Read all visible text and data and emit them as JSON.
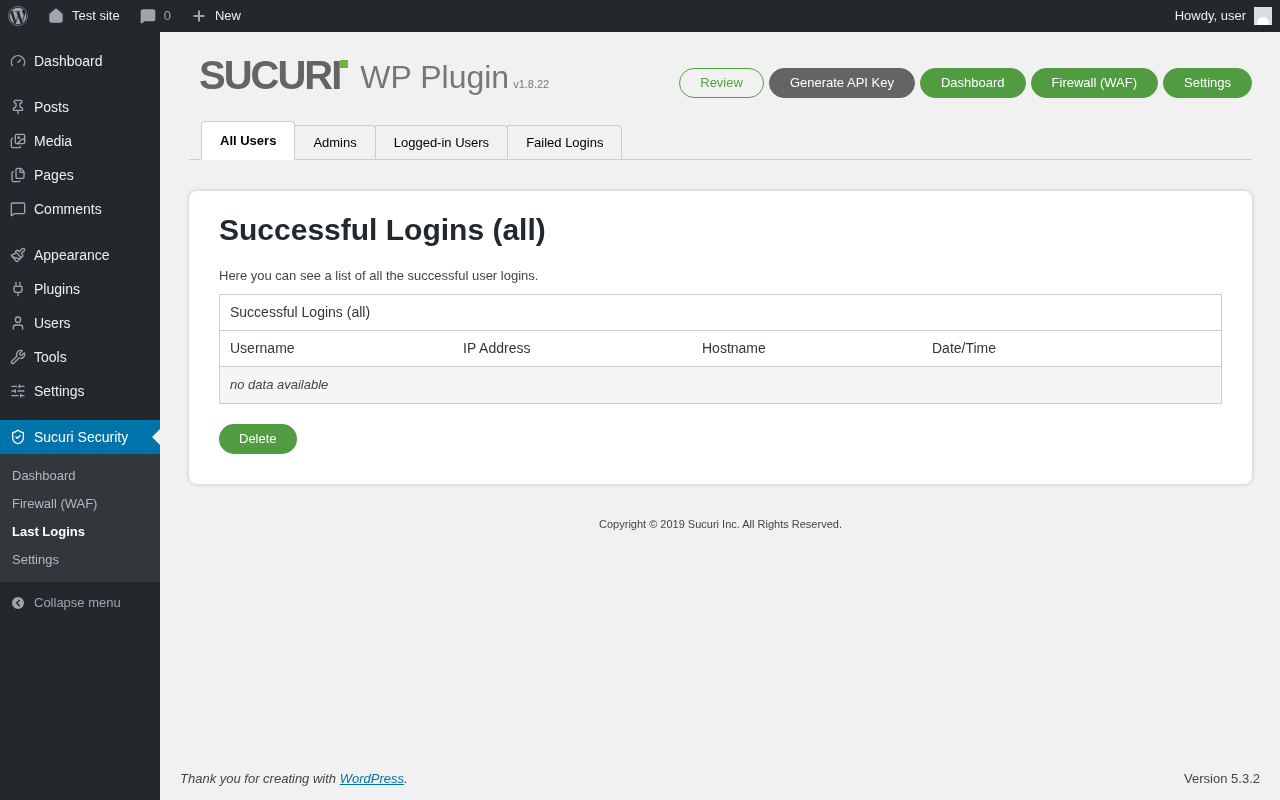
{
  "admin_bar": {
    "site": "Test site",
    "comments": "0",
    "new": "New",
    "greeting": "Howdy, user"
  },
  "sidebar": {
    "groups": [
      [
        {
          "label": "Dashboard",
          "kind": "dashboard"
        }
      ],
      [
        {
          "label": "Posts",
          "kind": "posts"
        },
        {
          "label": "Media",
          "kind": "media"
        },
        {
          "label": "Pages",
          "kind": "pages"
        },
        {
          "label": "Comments",
          "kind": "comments"
        }
      ],
      [
        {
          "label": "Appearance",
          "kind": "appearance"
        },
        {
          "label": "Plugins",
          "kind": "plugins"
        },
        {
          "label": "Users",
          "kind": "users"
        },
        {
          "label": "Tools",
          "kind": "tools"
        },
        {
          "label": "Settings",
          "kind": "settings"
        }
      ]
    ],
    "active": {
      "label": "Sucuri Security",
      "selected": true
    },
    "submenu": [
      {
        "label": "Dashboard",
        "selected": false
      },
      {
        "label": "Firewall (WAF)",
        "selected": false
      },
      {
        "label": "Last Logins",
        "selected": true
      },
      {
        "label": "Settings",
        "selected": false
      }
    ],
    "collapse": "Collapse menu"
  },
  "header": {
    "logo": "SUCURI",
    "title": "WP Plugin",
    "version": "v1.8.22",
    "buttons": [
      {
        "label": "Review",
        "kind": "outline"
      },
      {
        "label": "Generate API Key",
        "kind": "dark"
      },
      {
        "label": "Dashboard",
        "kind": "primary"
      },
      {
        "label": "Firewall (WAF)",
        "kind": "primary"
      },
      {
        "label": "Settings",
        "kind": "primary"
      }
    ]
  },
  "tabs": [
    {
      "label": "All Users",
      "selected": true
    },
    {
      "label": "Admins",
      "selected": false
    },
    {
      "label": "Logged-in Users",
      "selected": false
    },
    {
      "label": "Failed Logins",
      "selected": false
    }
  ],
  "panel": {
    "title": "Successful Logins (all)",
    "description": "Here you can see a list of all the successful user logins.",
    "table": {
      "caption": "Successful Logins (all)",
      "columns": [
        "Username",
        "IP Address",
        "Hostname",
        "Date/Time"
      ],
      "empty": "no data available"
    },
    "delete_button": "Delete"
  },
  "copyright": "Copyright © 2019 Sucuri Inc. All Rights Reserved.",
  "footer": {
    "thanks": "Thank you for creating with",
    "link": "WordPress",
    "end": ".",
    "version": "Version 5.3.2"
  }
}
